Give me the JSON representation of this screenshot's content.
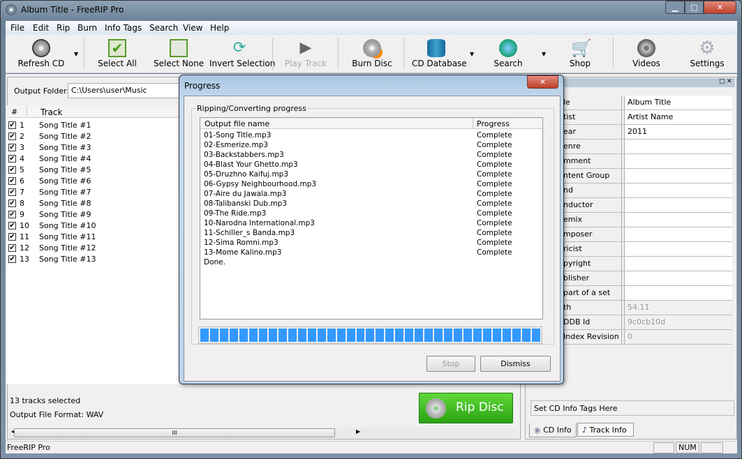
{
  "window": {
    "title": "Album Title - FreeRIP Pro",
    "minimize": "▁",
    "maximize": "□",
    "close": "✕"
  },
  "menu": [
    "File",
    "Edit",
    "Rip",
    "Burn",
    "Info Tags",
    "Search",
    "View",
    "Help"
  ],
  "toolbar": [
    {
      "label": "Refresh CD",
      "icon": "cd-drive-icon"
    },
    {
      "label": "Select All",
      "icon": "checkbox-checked-icon"
    },
    {
      "label": "Select None",
      "icon": "checkbox-empty-icon"
    },
    {
      "label": "Invert Selection",
      "icon": "invert-icon"
    },
    {
      "label": "Play Track",
      "icon": "play-icon",
      "disabled": true
    },
    {
      "label": "Burn Disc",
      "icon": "burn-disc-icon"
    },
    {
      "label": "CD Database",
      "icon": "database-icon"
    },
    {
      "label": "Search",
      "icon": "globe-search-icon"
    },
    {
      "label": "Shop",
      "icon": "cart-icon"
    },
    {
      "label": "Videos",
      "icon": "film-reel-icon"
    },
    {
      "label": "Settings",
      "icon": "gear-icon"
    }
  ],
  "left": {
    "output_folder_label": "Output Folder:",
    "output_folder_value": "C:\\Users\\user\\Music",
    "columns": [
      "#",
      "Track"
    ],
    "tracks": [
      {
        "n": "1",
        "title": "Song Title #1"
      },
      {
        "n": "2",
        "title": "Song Title #2"
      },
      {
        "n": "3",
        "title": "Song Title #3"
      },
      {
        "n": "4",
        "title": "Song Title #4"
      },
      {
        "n": "5",
        "title": "Song Title #5"
      },
      {
        "n": "6",
        "title": "Song Title #6"
      },
      {
        "n": "7",
        "title": "Song Title #7"
      },
      {
        "n": "8",
        "title": "Song Title #8"
      },
      {
        "n": "9",
        "title": "Song Title #9"
      },
      {
        "n": "10",
        "title": "Song Title #10"
      },
      {
        "n": "11",
        "title": "Song Title #11"
      },
      {
        "n": "12",
        "title": "Song Title #12"
      },
      {
        "n": "13",
        "title": "Song Title #13"
      }
    ],
    "selected_count": "13 tracks selected",
    "format": "Output File Format: WAV",
    "rip_button": "Rip Disc",
    "scroll_grip": "III"
  },
  "right": {
    "rows": [
      {
        "label": "le",
        "value": "Album Title"
      },
      {
        "label": "tist",
        "value": "Artist Name"
      },
      {
        "label": "ear",
        "value": "2011"
      },
      {
        "label": "enre",
        "value": ""
      },
      {
        "label": "mment",
        "value": ""
      },
      {
        "label": "ntent Group",
        "value": ""
      },
      {
        "label": "nd",
        "value": ""
      },
      {
        "label": "nductor",
        "value": ""
      },
      {
        "label": "emix",
        "value": ""
      },
      {
        "label": "mposer",
        "value": ""
      },
      {
        "label": "ricist",
        "value": ""
      },
      {
        "label": "pyright",
        "value": ""
      },
      {
        "label": "blisher",
        "value": ""
      },
      {
        "label": "part of a set",
        "value": ""
      },
      {
        "label": "th",
        "value": "54.11",
        "readonly": true
      },
      {
        "label": "DDB Id",
        "value": "9c0cb10d",
        "readonly": true
      },
      {
        "label": "Index Revision",
        "value": "0",
        "readonly": true
      }
    ],
    "hint": "Set CD Info Tags Here",
    "tabs": [
      "CD Info",
      "Track Info"
    ]
  },
  "dialog": {
    "title": "Progress",
    "close": "✕",
    "group_label": "Ripping/Converting progress",
    "columns": [
      "Output file name",
      "Progress"
    ],
    "rows": [
      {
        "file": "01-Song Title.mp3",
        "status": "Complete"
      },
      {
        "file": "02-Esmerize.mp3",
        "status": "Complete"
      },
      {
        "file": "03-Backstabbers.mp3",
        "status": "Complete"
      },
      {
        "file": "04-Blast Your Ghetto.mp3",
        "status": "Complete"
      },
      {
        "file": "05-Druzhno Kaifuj.mp3",
        "status": "Complete"
      },
      {
        "file": "06-Gypsy Neighbourhood.mp3",
        "status": "Complete"
      },
      {
        "file": "07-Aire du Jawala.mp3",
        "status": "Complete"
      },
      {
        "file": "08-Talibanski Dub.mp3",
        "status": "Complete"
      },
      {
        "file": "09-The Ride.mp3",
        "status": "Complete"
      },
      {
        "file": "10-Narodna International.mp3",
        "status": "Complete"
      },
      {
        "file": "11-Schiller_s Banda.mp3",
        "status": "Complete"
      },
      {
        "file": "12-Sima Romni.mp3",
        "status": "Complete"
      },
      {
        "file": "13-Mome Kalino.mp3",
        "status": "Complete"
      }
    ],
    "done": "Done.",
    "progress_percent": 100,
    "stop": "Stop",
    "dismiss": "Dismiss"
  },
  "statusbar": {
    "text": "FreeRIP Pro",
    "num": "NUM"
  },
  "colors": {
    "progress": "#3399ff",
    "rip_button": "#3cbf1e"
  }
}
